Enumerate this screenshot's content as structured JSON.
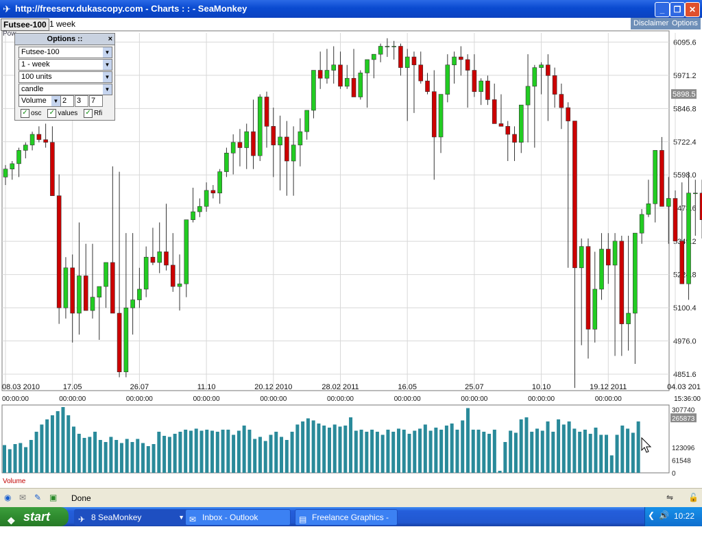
{
  "window": {
    "title": "http://freeserv.dukascopy.com - Charts : : - SeaMonkey",
    "buttons": {
      "minimize": "_",
      "maximize": "❐",
      "close": "✕"
    }
  },
  "toolbar": {
    "symbol": "Futsee-100",
    "period": "1 week",
    "disclaimer": "Disclaimer",
    "options": "Options",
    "powered_fragment": "Pow"
  },
  "options_panel": {
    "title": "Options ::",
    "close": "×",
    "instrument": "Futsee-100",
    "period": "1 - week",
    "units": "100 units",
    "chart_style": "candle",
    "indicator": "Volume",
    "param1": "2",
    "param2": "3",
    "param3": "7",
    "check_osc": "osc",
    "check_values": "values",
    "check_rfi": "Rfi"
  },
  "volume_label": "Volume",
  "status": {
    "text": "Done"
  },
  "taskbar": {
    "start": "start",
    "items": [
      {
        "label": "8 SeaMonkey",
        "active": true
      },
      {
        "label": "Inbox - Outlook Express",
        "active": false
      },
      {
        "label": "Freelance Graphics - ...",
        "active": false
      }
    ],
    "clock": "10:22"
  },
  "colors": {
    "up": "#22cc22",
    "down": "#cc0000",
    "volume": "#2a8a9a",
    "grid": "#d8d8d8"
  },
  "chart_data": [
    {
      "type": "candlestick",
      "ylim": [
        4790,
        6130
      ],
      "y_ticks": [
        "6095.6",
        "5971.2",
        "5846.8",
        "5722.4",
        "5598.0",
        "5473.6",
        "5349.2",
        "5224.8",
        "5100.4",
        "4976.0",
        "4851.6"
      ],
      "y_tick_values": [
        6095.6,
        5971.2,
        5846.8,
        5722.4,
        5598.0,
        5473.6,
        5349.2,
        5224.8,
        5100.4,
        4976.0,
        4851.6
      ],
      "last_value_label": "5898.5",
      "last_value": 5898.5,
      "x_labels": [
        "08.03 2010",
        "17.05",
        "26.07",
        "11.10",
        "20.12 2010",
        "28.02 2011",
        "16.05",
        "25.07",
        "10.10",
        "19.12 2011",
        "04.03 201"
      ],
      "x_label_index": [
        0,
        10,
        20,
        30,
        40,
        50,
        60,
        70,
        80,
        90,
        100
      ],
      "time_labels": [
        "00:00:00",
        "00:00:00",
        "00:00:00",
        "00:00:00",
        "00:00:00",
        "00:00:00",
        "00:00:00",
        "00:00:00",
        "00:00:00",
        "00:00:00",
        "15:36:00"
      ],
      "candles": [
        [
          5590,
          5635,
          5560,
          5620
        ],
        [
          5620,
          5650,
          5580,
          5640
        ],
        [
          5640,
          5700,
          5590,
          5690
        ],
        [
          5690,
          5720,
          5660,
          5710
        ],
        [
          5710,
          5760,
          5690,
          5750
        ],
        [
          5750,
          5780,
          5720,
          5730
        ],
        [
          5730,
          5790,
          5700,
          5720
        ],
        [
          5720,
          5780,
          5520,
          5520
        ],
        [
          5520,
          5600,
          5040,
          5100
        ],
        [
          5100,
          5290,
          5060,
          5250
        ],
        [
          5250,
          5300,
          4970,
          5080
        ],
        [
          5080,
          5420,
          5000,
          5220
        ],
        [
          5220,
          5340,
          5110,
          5090
        ],
        [
          5090,
          5340,
          5060,
          5140
        ],
        [
          5140,
          5170,
          4980,
          5180
        ],
        [
          5180,
          5270,
          5100,
          5270
        ],
        [
          5270,
          5630,
          5110,
          5080
        ],
        [
          5080,
          5610,
          4840,
          4860
        ],
        [
          4860,
          5380,
          4840,
          5100
        ],
        [
          5100,
          5380,
          5000,
          5130
        ],
        [
          5130,
          5250,
          5100,
          5170
        ],
        [
          5170,
          5330,
          5140,
          5290
        ],
        [
          5290,
          5400,
          5260,
          5270
        ],
        [
          5270,
          5420,
          5230,
          5310
        ],
        [
          5310,
          5490,
          5240,
          5260
        ],
        [
          5260,
          5380,
          5160,
          5180
        ],
        [
          5180,
          5300,
          5090,
          5190
        ],
        [
          5190,
          5290,
          5140,
          5430
        ],
        [
          5430,
          5550,
          5420,
          5460
        ],
        [
          5460,
          5510,
          5440,
          5480
        ],
        [
          5480,
          5570,
          5460,
          5540
        ],
        [
          5540,
          5560,
          5510,
          5530
        ],
        [
          5530,
          5620,
          5490,
          5610
        ],
        [
          5610,
          5700,
          5590,
          5680
        ],
        [
          5680,
          5750,
          5600,
          5720
        ],
        [
          5720,
          5770,
          5630,
          5700
        ],
        [
          5700,
          5790,
          5620,
          5760
        ],
        [
          5760,
          5880,
          5620,
          5670
        ],
        [
          5670,
          5900,
          5650,
          5890
        ],
        [
          5890,
          5910,
          5700,
          5780
        ],
        [
          5780,
          5850,
          5590,
          5710
        ],
        [
          5710,
          5820,
          5540,
          5740
        ],
        [
          5740,
          5800,
          5520,
          5650
        ],
        [
          5650,
          5780,
          5520,
          5710
        ],
        [
          5710,
          5810,
          5630,
          5760
        ],
        [
          5760,
          5820,
          5730,
          5840
        ],
        [
          5840,
          5890,
          5810,
          5990
        ],
        [
          5990,
          6060,
          5920,
          5960
        ],
        [
          5960,
          6070,
          5940,
          5990
        ],
        [
          5990,
          6080,
          5940,
          6010
        ],
        [
          6010,
          6060,
          5920,
          5930
        ],
        [
          5930,
          6010,
          5920,
          5960
        ],
        [
          5960,
          6070,
          5910,
          5890
        ],
        [
          5890,
          5990,
          5880,
          5980
        ],
        [
          5980,
          6010,
          5850,
          6030
        ],
        [
          6030,
          6050,
          5960,
          6050
        ],
        [
          6050,
          6090,
          6020,
          6080
        ],
        [
          6080,
          6110,
          6040,
          6080
        ],
        [
          6080,
          6100,
          6030,
          6080
        ],
        [
          6080,
          6090,
          5970,
          6000
        ],
        [
          6000,
          6070,
          5800,
          6040
        ],
        [
          6040,
          6060,
          5830,
          6010
        ],
        [
          6010,
          6060,
          5940,
          5950
        ],
        [
          5950,
          5980,
          5900,
          5910
        ],
        [
          5910,
          5990,
          5580,
          5740
        ],
        [
          5740,
          5890,
          5680,
          5900
        ],
        [
          5900,
          6050,
          5870,
          6010
        ],
        [
          6010,
          6060,
          5940,
          6040
        ],
        [
          6040,
          6080,
          5970,
          6030
        ],
        [
          6030,
          6050,
          5850,
          5990
        ],
        [
          5990,
          6050,
          5890,
          5910
        ],
        [
          5910,
          5960,
          5860,
          5950
        ],
        [
          5950,
          5970,
          5860,
          5880
        ],
        [
          5880,
          5940,
          5820,
          5790
        ],
        [
          5790,
          5900,
          5780,
          5780
        ],
        [
          5780,
          5800,
          5650,
          5750
        ],
        [
          5750,
          5780,
          5650,
          5720
        ],
        [
          5720,
          5790,
          5680,
          5860
        ],
        [
          5860,
          6050,
          5720,
          5930
        ],
        [
          5930,
          6010,
          5700,
          6000
        ],
        [
          6000,
          6020,
          5900,
          6010
        ],
        [
          6010,
          6050,
          5800,
          5970
        ],
        [
          5970,
          6000,
          5850,
          5900
        ],
        [
          5900,
          5940,
          5770,
          5850
        ],
        [
          5850,
          5870,
          5250,
          5800
        ],
        [
          5800,
          5800,
          4800,
          5250
        ],
        [
          5250,
          5360,
          4960,
          5330
        ],
        [
          5330,
          5360,
          4910,
          5020
        ],
        [
          5020,
          5310,
          4970,
          5170
        ],
        [
          5170,
          5380,
          5130,
          5320
        ],
        [
          5320,
          5380,
          5190,
          5260
        ],
        [
          5260,
          5380,
          4920,
          5350
        ],
        [
          5350,
          5370,
          4920,
          5040
        ],
        [
          5040,
          5370,
          4940,
          5080
        ],
        [
          5080,
          5370,
          4890,
          5380
        ],
        [
          5380,
          5470,
          5340,
          5450
        ],
        [
          5450,
          5580,
          5440,
          5490
        ],
        [
          5490,
          5640,
          5420,
          5690
        ],
        [
          5690,
          5740,
          5480,
          5480
        ],
        [
          5480,
          5590,
          5340,
          5510
        ],
        [
          5510,
          5540,
          5480,
          5350
        ],
        [
          5350,
          5570,
          5240,
          5190
        ],
        [
          5190,
          5610,
          5130,
          5530
        ],
        [
          5530,
          5580,
          5370,
          5530
        ],
        [
          5530,
          5580,
          5360,
          5430
        ],
        [
          5430,
          5550,
          5320,
          5540
        ],
        [
          5540,
          5580,
          5500,
          5590
        ],
        [
          5590,
          5670,
          5570,
          5650
        ],
        [
          5650,
          5700,
          5600,
          5640
        ],
        [
          5640,
          5710,
          5620,
          5720
        ],
        [
          5720,
          5760,
          5680,
          5730
        ],
        [
          5730,
          5900,
          5660,
          5890
        ]
      ]
    },
    {
      "type": "bar",
      "ylim": [
        0,
        330000
      ],
      "y_ticks": [
        "307740",
        "265873",
        "123096",
        "61548",
        "0"
      ],
      "y_tick_values": [
        307740,
        265873,
        123096,
        61548,
        0
      ],
      "highlight_tick": "265873",
      "values": [
        135000,
        115000,
        140000,
        145000,
        125000,
        160000,
        200000,
        235000,
        260000,
        280000,
        300000,
        320000,
        280000,
        225000,
        190000,
        170000,
        175000,
        200000,
        160000,
        150000,
        175000,
        160000,
        145000,
        165000,
        150000,
        165000,
        145000,
        130000,
        140000,
        200000,
        180000,
        175000,
        190000,
        200000,
        210000,
        205000,
        215000,
        205000,
        210000,
        205000,
        200000,
        210000,
        210000,
        185000,
        205000,
        230000,
        210000,
        165000,
        175000,
        155000,
        185000,
        200000,
        175000,
        160000,
        200000,
        235000,
        250000,
        265000,
        255000,
        240000,
        230000,
        220000,
        235000,
        225000,
        230000,
        270000,
        205000,
        210000,
        200000,
        210000,
        200000,
        185000,
        210000,
        200000,
        215000,
        210000,
        190000,
        205000,
        215000,
        235000,
        205000,
        220000,
        210000,
        230000,
        240000,
        210000,
        255000,
        315000,
        210000,
        210000,
        200000,
        190000,
        210000,
        10000,
        150000,
        205000,
        195000,
        260000,
        270000,
        200000,
        215000,
        205000,
        250000,
        200000,
        260000,
        235000,
        250000,
        215000,
        200000,
        210000,
        190000,
        220000,
        185000,
        185000,
        85000,
        185000,
        230000,
        215000,
        195000,
        250000
      ]
    }
  ]
}
